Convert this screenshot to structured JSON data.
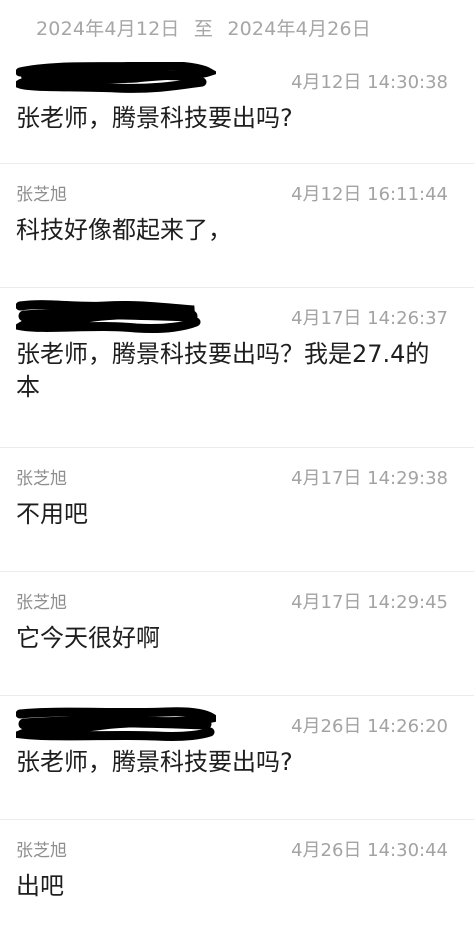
{
  "header": {
    "start_date": "2024年4月12日",
    "separator": "至",
    "end_date": "2024年4月26日"
  },
  "messages": [
    {
      "sender": "",
      "redacted": true,
      "time": "4月12日 14:30:38",
      "text": "张老师，腾景科技要出吗?"
    },
    {
      "sender": "张芝旭",
      "redacted": false,
      "time": "4月12日 16:11:44",
      "text": "科技好像都起来了，"
    },
    {
      "sender": "",
      "redacted": true,
      "time": "4月17日 14:26:37",
      "text": "张老师，腾景科技要出吗？我是27.4的本"
    },
    {
      "sender": "张芝旭",
      "redacted": false,
      "time": "4月17日 14:29:38",
      "text": "不用吧"
    },
    {
      "sender": "张芝旭",
      "redacted": false,
      "time": "4月17日 14:29:45",
      "text": "它今天很好啊"
    },
    {
      "sender": "",
      "redacted": true,
      "time": "4月26日 14:26:20",
      "text": "张老师，腾景科技要出吗?"
    },
    {
      "sender": "张芝旭",
      "redacted": false,
      "time": "4月26日 14:30:44",
      "text": "出吧"
    }
  ]
}
